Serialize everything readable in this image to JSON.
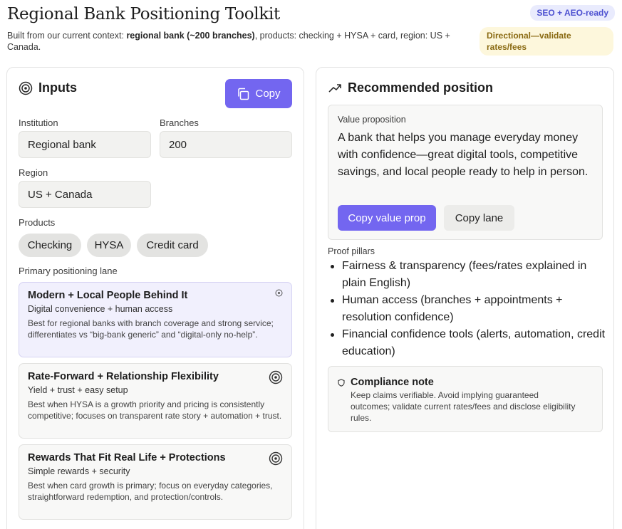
{
  "header": {
    "title": "Regional Bank Positioning Toolkit",
    "subtitle_prefix": "Built from our current context: ",
    "subtitle_bold": "regional bank (~200 branches)",
    "subtitle_suffix": ", products: checking + HYSA + card, region: US + Canada.",
    "badge_seo": "SEO + AEO-ready",
    "badge_directional": "Directional—validate rates/fees"
  },
  "inputs": {
    "title": "Inputs",
    "copy_label": "Copy",
    "institution_label": "Institution",
    "institution_value": "Regional bank",
    "branches_label": "Branches",
    "branches_value": "200",
    "region_label": "Region",
    "region_value": "US + Canada",
    "products_label": "Products",
    "products": [
      "Checking",
      "HYSA",
      "Credit card"
    ],
    "lane_label": "Primary positioning lane",
    "lanes": [
      {
        "title": "Modern + Local People Behind It",
        "subtitle": "Digital convenience + human access",
        "description": "Best for regional banks with branch coverage and strong service; differentiates vs “big-bank generic” and “digital-only no-help”.",
        "selected": true
      },
      {
        "title": "Rate-Forward + Relationship Flexibility",
        "subtitle": "Yield + trust + easy setup",
        "description": "Best when HYSA is a growth priority and pricing is consistently competitive; focuses on transparent rate story + automation + trust.",
        "selected": false
      },
      {
        "title": "Rewards That Fit Real Life + Protections",
        "subtitle": "Simple rewards + security",
        "description": "Best when card growth is primary; focus on everyday categories, straightforward redemption, and protection/controls.",
        "selected": false
      }
    ]
  },
  "recommended": {
    "title": "Recommended position",
    "vp_label": "Value proposition",
    "vp_text": "A bank that helps you manage everyday money with confidence—great digital tools, competitive savings, and local people ready to help in person.",
    "copy_vp_label": "Copy value prop",
    "copy_lane_label": "Copy lane",
    "pillars_label": "Proof pillars",
    "pillars": [
      "Fairness & transparency (fees/rates explained in plain English)",
      "Human access (branches + appointments + resolution confidence)",
      "Financial confidence tools (alerts, automation, credit education)"
    ],
    "note_title": "Compliance note",
    "note_text": "Keep claims verifiable. Avoid implying guaranteed outcomes; validate current rates/fees and disclose eligibility rules."
  },
  "colors": {
    "accent": "#7366f0",
    "badge_seo_bg": "#e9ebfd",
    "badge_dir_bg": "#fdf7dc"
  },
  "icons": [
    "target-icon",
    "copy-icon",
    "trend-up-icon",
    "shield-icon"
  ]
}
